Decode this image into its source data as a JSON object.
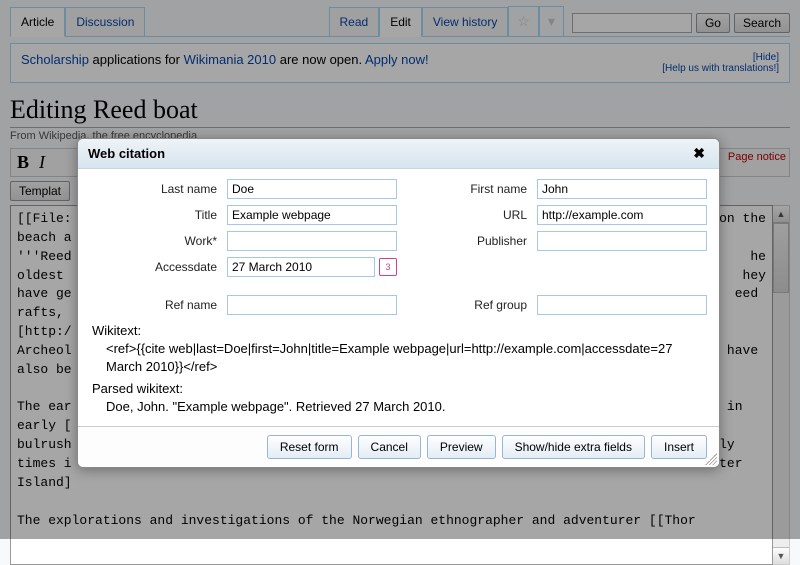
{
  "tabs": {
    "article": "Article",
    "discussion": "Discussion",
    "read": "Read",
    "edit": "Edit",
    "history": "View history"
  },
  "search": {
    "go": "Go",
    "search": "Search",
    "value": ""
  },
  "notice": {
    "text_1": "Scholarship",
    "text_2": " applications for ",
    "text_3": "Wikimania 2010",
    "text_4": " are now open. ",
    "text_5": "Apply now!",
    "hide": "[Hide]",
    "help": "[Help us with translations!]"
  },
  "heading": "Editing Reed boat",
  "subheading": "From Wikipedia, the free encyclopedia",
  "toolbar": {
    "bold": "B",
    "italic": "I",
    "templates": "Templat"
  },
  "page_notice": "Page notice",
  "editor_text": "[[File:                                                                                   on the\nbeach a\n'''Reed                                                                                       he\noldest                                                                                       hey\nhave ge                                                                                     eed\nrafts,\n[http:/\nArcheol                                                                                  s have\nalso be\n\nThe ear                                                                                  d in\nearly [\nbulrush                                                                                   ly\ntimes i                                                                                  ster\nIsland]\n\nThe explorations and investigations of the Norwegian ethnographer and adventurer [[Thor",
  "dialog": {
    "title": "Web citation",
    "labels": {
      "last_name": "Last name",
      "first_name": "First name",
      "title": "Title",
      "url": "URL",
      "work": "Work*",
      "publisher": "Publisher",
      "accessdate": "Accessdate",
      "ref_name": "Ref name",
      "ref_group": "Ref group"
    },
    "values": {
      "last_name": "Doe",
      "first_name": "John",
      "title": "Example webpage",
      "url": "http://example.com",
      "work": "",
      "publisher": "",
      "accessdate": "27 March 2010",
      "ref_name": "",
      "ref_group": ""
    },
    "wikitext_label": "Wikitext:",
    "wikitext": "<ref>{{cite web|last=Doe|first=John|title=Example webpage|url=http://example.com|accessdate=27 March 2010}}</ref>",
    "parsed_label": "Parsed wikitext:",
    "parsed": "Doe, John. \"Example webpage\". Retrieved 27 March 2010.",
    "buttons": {
      "reset": "Reset form",
      "cancel": "Cancel",
      "preview": "Preview",
      "extra": "Show/hide extra fields",
      "insert": "Insert"
    }
  }
}
